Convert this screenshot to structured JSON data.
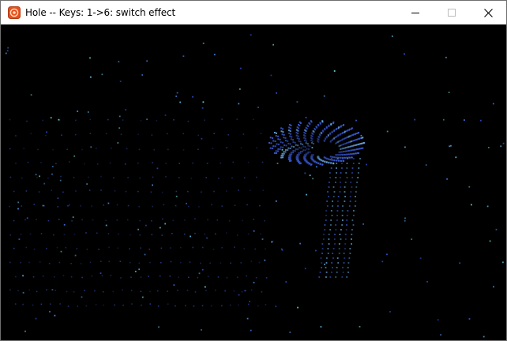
{
  "window": {
    "title": "Hole -- Keys: 1->6: switch effect",
    "app_icon": "flame-app-icon",
    "controls": {
      "minimize_icon": "minimize-icon",
      "maximize_icon": "maximize-icon",
      "close_icon": "close-icon"
    }
  },
  "scene": {
    "background_color": "#000000",
    "effect": "hole",
    "star_colors": [
      "#4a8bd6",
      "#5fb3d9",
      "#3d6fd1",
      "#6ad3c8",
      "#2f4fcf"
    ],
    "hole_color": "#3b5bd8"
  }
}
